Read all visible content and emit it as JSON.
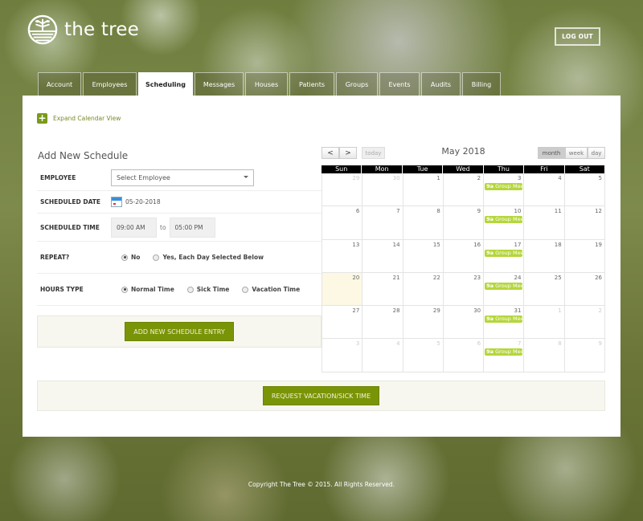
{
  "header": {
    "logo_text": "the tree",
    "logout_label": "LOG OUT"
  },
  "tabs": [
    {
      "label": "Account",
      "active": false
    },
    {
      "label": "Employees",
      "active": false
    },
    {
      "label": "Scheduling",
      "active": true
    },
    {
      "label": "Messages",
      "active": false
    },
    {
      "label": "Houses",
      "active": false
    },
    {
      "label": "Patients",
      "active": false
    },
    {
      "label": "Groups",
      "active": false
    },
    {
      "label": "Events",
      "active": false
    },
    {
      "label": "Audits",
      "active": false
    },
    {
      "label": "Billing",
      "active": false
    }
  ],
  "expand": {
    "icon": "plus-icon",
    "label": "Expand Calendar View"
  },
  "form": {
    "title": "Add New Schedule",
    "employee_label": "EMPLOYEE",
    "employee_placeholder": "Select Employee",
    "date_label": "SCHEDULED DATE",
    "date_value": "05-20-2018",
    "time_label": "SCHEDULED TIME",
    "time_start": "09:00 AM",
    "time_sep": "to",
    "time_end": "05:00 PM",
    "repeat_label": "REPEAT?",
    "repeat_options": [
      {
        "label": "No",
        "selected": true
      },
      {
        "label": "Yes, Each Day Selected Below",
        "selected": false
      }
    ],
    "hours_label": "HOURS TYPE",
    "hours_options": [
      {
        "label": "Normal Time",
        "selected": true
      },
      {
        "label": "Sick Time",
        "selected": false
      },
      {
        "label": "Vacation Time",
        "selected": false
      }
    ],
    "submit_label": "ADD NEW SCHEDULE ENTRY"
  },
  "calendar": {
    "title": "May 2018",
    "prev_icon": "<",
    "next_icon": ">",
    "today_label": "today",
    "views": [
      {
        "label": "month",
        "active": true
      },
      {
        "label": "week",
        "active": false
      },
      {
        "label": "day",
        "active": false
      }
    ],
    "weekdays": [
      "Sun",
      "Mon",
      "Tue",
      "Wed",
      "Thu",
      "Fri",
      "Sat"
    ],
    "weeks": [
      [
        {
          "d": "29",
          "o": true
        },
        {
          "d": "30",
          "o": true
        },
        {
          "d": "1"
        },
        {
          "d": "2"
        },
        {
          "d": "3",
          "ev": true
        },
        {
          "d": "4"
        },
        {
          "d": "5"
        }
      ],
      [
        {
          "d": "6"
        },
        {
          "d": "7"
        },
        {
          "d": "8"
        },
        {
          "d": "9"
        },
        {
          "d": "10",
          "ev": true
        },
        {
          "d": "11"
        },
        {
          "d": "12"
        }
      ],
      [
        {
          "d": "13"
        },
        {
          "d": "14"
        },
        {
          "d": "15"
        },
        {
          "d": "16"
        },
        {
          "d": "17",
          "ev": true
        },
        {
          "d": "18"
        },
        {
          "d": "19"
        }
      ],
      [
        {
          "d": "20",
          "today": true
        },
        {
          "d": "21"
        },
        {
          "d": "22"
        },
        {
          "d": "23"
        },
        {
          "d": "24",
          "ev": true
        },
        {
          "d": "25"
        },
        {
          "d": "26"
        }
      ],
      [
        {
          "d": "27"
        },
        {
          "d": "28"
        },
        {
          "d": "29"
        },
        {
          "d": "30"
        },
        {
          "d": "31",
          "ev": true
        },
        {
          "d": "1",
          "o": true
        },
        {
          "d": "2",
          "o": true
        }
      ],
      [
        {
          "d": "3",
          "o": true
        },
        {
          "d": "4",
          "o": true
        },
        {
          "d": "5",
          "o": true
        },
        {
          "d": "6",
          "o": true
        },
        {
          "d": "7",
          "o": true,
          "ev": true
        },
        {
          "d": "8",
          "o": true
        },
        {
          "d": "9",
          "o": true
        }
      ]
    ],
    "event": {
      "time": "9a",
      "title": "Group Meeti"
    }
  },
  "request_label": "REQUEST VACATION/SICK TIME",
  "footer": "Copyright The Tree © 2015. All Rights Reserved.",
  "colors": {
    "accent": "#7a9408",
    "event": "#b5d63c",
    "today": "#fcf8e3"
  }
}
